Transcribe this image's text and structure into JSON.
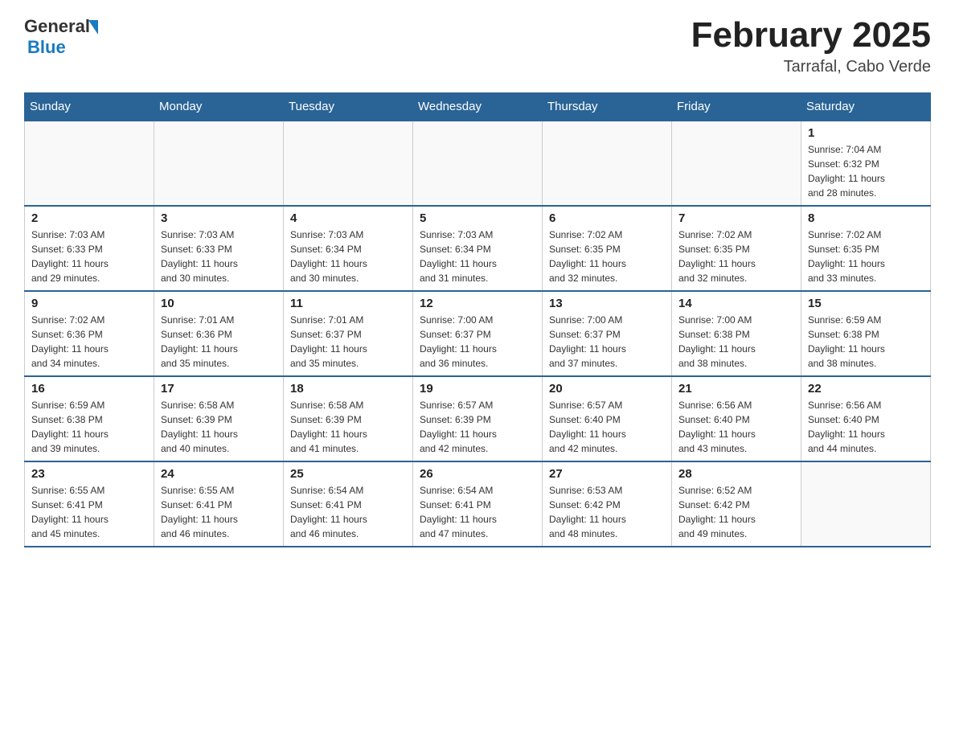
{
  "header": {
    "logo_general": "General",
    "logo_blue": "Blue",
    "month_title": "February 2025",
    "location": "Tarrafal, Cabo Verde"
  },
  "days_of_week": [
    "Sunday",
    "Monday",
    "Tuesday",
    "Wednesday",
    "Thursday",
    "Friday",
    "Saturday"
  ],
  "weeks": [
    [
      {
        "day": "",
        "info": ""
      },
      {
        "day": "",
        "info": ""
      },
      {
        "day": "",
        "info": ""
      },
      {
        "day": "",
        "info": ""
      },
      {
        "day": "",
        "info": ""
      },
      {
        "day": "",
        "info": ""
      },
      {
        "day": "1",
        "info": "Sunrise: 7:04 AM\nSunset: 6:32 PM\nDaylight: 11 hours\nand 28 minutes."
      }
    ],
    [
      {
        "day": "2",
        "info": "Sunrise: 7:03 AM\nSunset: 6:33 PM\nDaylight: 11 hours\nand 29 minutes."
      },
      {
        "day": "3",
        "info": "Sunrise: 7:03 AM\nSunset: 6:33 PM\nDaylight: 11 hours\nand 30 minutes."
      },
      {
        "day": "4",
        "info": "Sunrise: 7:03 AM\nSunset: 6:34 PM\nDaylight: 11 hours\nand 30 minutes."
      },
      {
        "day": "5",
        "info": "Sunrise: 7:03 AM\nSunset: 6:34 PM\nDaylight: 11 hours\nand 31 minutes."
      },
      {
        "day": "6",
        "info": "Sunrise: 7:02 AM\nSunset: 6:35 PM\nDaylight: 11 hours\nand 32 minutes."
      },
      {
        "day": "7",
        "info": "Sunrise: 7:02 AM\nSunset: 6:35 PM\nDaylight: 11 hours\nand 32 minutes."
      },
      {
        "day": "8",
        "info": "Sunrise: 7:02 AM\nSunset: 6:35 PM\nDaylight: 11 hours\nand 33 minutes."
      }
    ],
    [
      {
        "day": "9",
        "info": "Sunrise: 7:02 AM\nSunset: 6:36 PM\nDaylight: 11 hours\nand 34 minutes."
      },
      {
        "day": "10",
        "info": "Sunrise: 7:01 AM\nSunset: 6:36 PM\nDaylight: 11 hours\nand 35 minutes."
      },
      {
        "day": "11",
        "info": "Sunrise: 7:01 AM\nSunset: 6:37 PM\nDaylight: 11 hours\nand 35 minutes."
      },
      {
        "day": "12",
        "info": "Sunrise: 7:00 AM\nSunset: 6:37 PM\nDaylight: 11 hours\nand 36 minutes."
      },
      {
        "day": "13",
        "info": "Sunrise: 7:00 AM\nSunset: 6:37 PM\nDaylight: 11 hours\nand 37 minutes."
      },
      {
        "day": "14",
        "info": "Sunrise: 7:00 AM\nSunset: 6:38 PM\nDaylight: 11 hours\nand 38 minutes."
      },
      {
        "day": "15",
        "info": "Sunrise: 6:59 AM\nSunset: 6:38 PM\nDaylight: 11 hours\nand 38 minutes."
      }
    ],
    [
      {
        "day": "16",
        "info": "Sunrise: 6:59 AM\nSunset: 6:38 PM\nDaylight: 11 hours\nand 39 minutes."
      },
      {
        "day": "17",
        "info": "Sunrise: 6:58 AM\nSunset: 6:39 PM\nDaylight: 11 hours\nand 40 minutes."
      },
      {
        "day": "18",
        "info": "Sunrise: 6:58 AM\nSunset: 6:39 PM\nDaylight: 11 hours\nand 41 minutes."
      },
      {
        "day": "19",
        "info": "Sunrise: 6:57 AM\nSunset: 6:39 PM\nDaylight: 11 hours\nand 42 minutes."
      },
      {
        "day": "20",
        "info": "Sunrise: 6:57 AM\nSunset: 6:40 PM\nDaylight: 11 hours\nand 42 minutes."
      },
      {
        "day": "21",
        "info": "Sunrise: 6:56 AM\nSunset: 6:40 PM\nDaylight: 11 hours\nand 43 minutes."
      },
      {
        "day": "22",
        "info": "Sunrise: 6:56 AM\nSunset: 6:40 PM\nDaylight: 11 hours\nand 44 minutes."
      }
    ],
    [
      {
        "day": "23",
        "info": "Sunrise: 6:55 AM\nSunset: 6:41 PM\nDaylight: 11 hours\nand 45 minutes."
      },
      {
        "day": "24",
        "info": "Sunrise: 6:55 AM\nSunset: 6:41 PM\nDaylight: 11 hours\nand 46 minutes."
      },
      {
        "day": "25",
        "info": "Sunrise: 6:54 AM\nSunset: 6:41 PM\nDaylight: 11 hours\nand 46 minutes."
      },
      {
        "day": "26",
        "info": "Sunrise: 6:54 AM\nSunset: 6:41 PM\nDaylight: 11 hours\nand 47 minutes."
      },
      {
        "day": "27",
        "info": "Sunrise: 6:53 AM\nSunset: 6:42 PM\nDaylight: 11 hours\nand 48 minutes."
      },
      {
        "day": "28",
        "info": "Sunrise: 6:52 AM\nSunset: 6:42 PM\nDaylight: 11 hours\nand 49 minutes."
      },
      {
        "day": "",
        "info": ""
      }
    ]
  ]
}
